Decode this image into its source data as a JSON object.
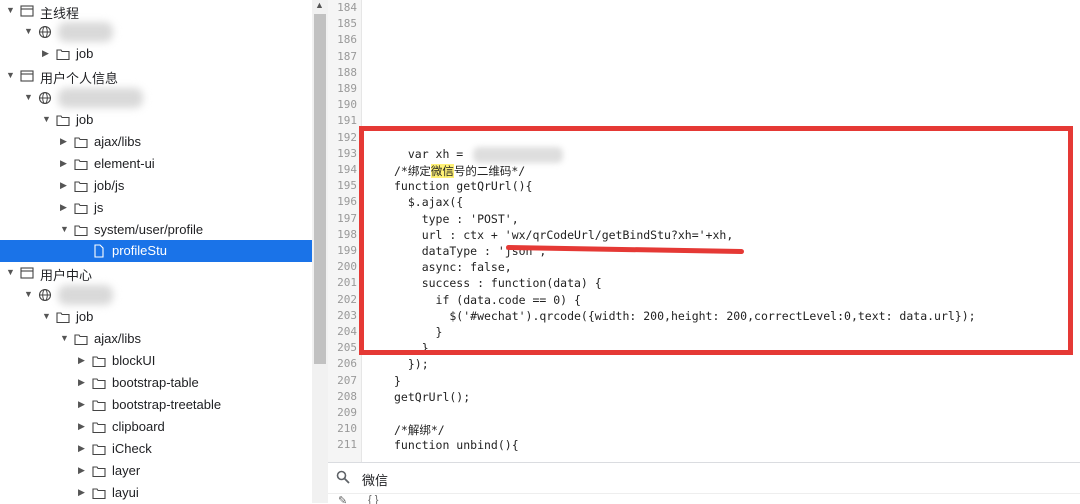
{
  "tree": {
    "items": [
      {
        "label": "主线程",
        "type": "frame"
      },
      {
        "label": "",
        "type": "origin",
        "redacted": true
      },
      {
        "label": "job",
        "type": "folder"
      },
      {
        "label": "用户个人信息",
        "type": "frame"
      },
      {
        "label": "",
        "type": "origin",
        "redacted": true
      },
      {
        "label": "job",
        "type": "folder"
      },
      {
        "label": "ajax/libs",
        "type": "folder"
      },
      {
        "label": "element-ui",
        "type": "folder"
      },
      {
        "label": "job/js",
        "type": "folder"
      },
      {
        "label": "js",
        "type": "folder"
      },
      {
        "label": "system/user/profile",
        "type": "folder"
      },
      {
        "label": "profileStu",
        "type": "file",
        "selected": true
      },
      {
        "label": "用户中心",
        "type": "frame"
      },
      {
        "label": "",
        "type": "origin",
        "redacted": true
      },
      {
        "label": "job",
        "type": "folder"
      },
      {
        "label": "ajax/libs",
        "type": "folder"
      },
      {
        "label": "blockUI",
        "type": "folder"
      },
      {
        "label": "bootstrap-table",
        "type": "folder"
      },
      {
        "label": "bootstrap-treetable",
        "type": "folder"
      },
      {
        "label": "clipboard",
        "type": "folder"
      },
      {
        "label": "iCheck",
        "type": "folder"
      },
      {
        "label": "layer",
        "type": "folder"
      },
      {
        "label": "layui",
        "type": "folder"
      }
    ]
  },
  "editor": {
    "lines": [
      {
        "n": "184",
        "code": ""
      },
      {
        "n": "185",
        "code": ""
      },
      {
        "n": "186",
        "code": ""
      },
      {
        "n": "187",
        "code": ""
      },
      {
        "n": "188",
        "code": ""
      },
      {
        "n": "189",
        "code": ""
      },
      {
        "n": "190",
        "code": ""
      },
      {
        "n": "191",
        "code": ""
      },
      {
        "n": "192",
        "code": ""
      },
      {
        "n": "193",
        "code": "  var xh = "
      },
      {
        "n": "194",
        "code_pre": "/*绑定",
        "code_hl": "微信",
        "code_post": "号的二维码*/"
      },
      {
        "n": "195",
        "code": "function getQrUrl(){"
      },
      {
        "n": "196",
        "code": "  $.ajax({"
      },
      {
        "n": "197",
        "code": "    type : 'POST',"
      },
      {
        "n": "198",
        "code": "    url : ctx + 'wx/qrCodeUrl/getBindStu?xh='+xh,"
      },
      {
        "n": "199",
        "code": "    dataType : 'json',"
      },
      {
        "n": "200",
        "code": "    async: false,"
      },
      {
        "n": "201",
        "code": "    success : function(data) {"
      },
      {
        "n": "202",
        "code": "      if (data.code == 0) {"
      },
      {
        "n": "203",
        "code": "        $('#wechat').qrcode({width: 200,height: 200,correctLevel:0,text: data.url});"
      },
      {
        "n": "204",
        "code": "      }"
      },
      {
        "n": "205",
        "code": "    }"
      },
      {
        "n": "206",
        "code": "  });"
      },
      {
        "n": "207",
        "code": "}"
      },
      {
        "n": "208",
        "code": "getQrUrl();"
      },
      {
        "n": "209",
        "code": ""
      },
      {
        "n": "210",
        "code": "/*解绑*/"
      },
      {
        "n": "211",
        "code": "function unbind(){"
      }
    ]
  },
  "search": {
    "value": "微信"
  },
  "bottombar": {
    "label": "{ }"
  },
  "colors": {
    "annotation": "#e53935",
    "selection": "#1a73e8",
    "highlight": "#fff176"
  }
}
